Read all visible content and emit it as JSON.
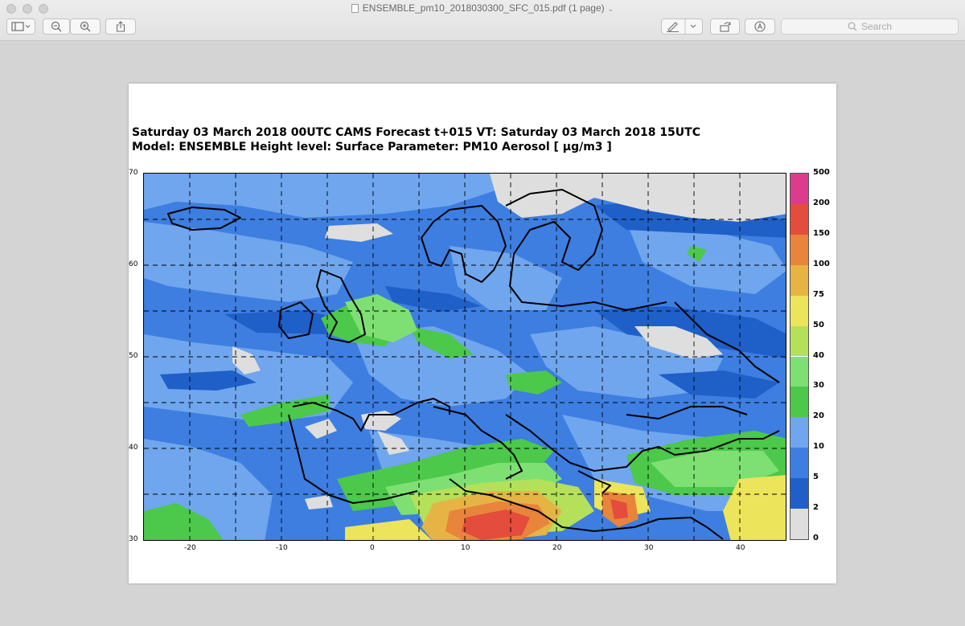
{
  "window": {
    "title": "ENSEMBLE_pm10_2018030300_SFC_015.pdf (1 page)"
  },
  "toolbar": {
    "search_placeholder": "Search",
    "icons": [
      "sidebar-icon",
      "zoom-out-icon",
      "zoom-in-icon",
      "share-icon",
      "markup-pen-icon",
      "rotate-icon",
      "annotate-icon",
      "search-icon"
    ]
  },
  "chart": {
    "title_line1": "Saturday 03 March 2018 00UTC CAMS Forecast t+015 VT: Saturday 03 March 2018 15UTC",
    "title_line2": "Model: ENSEMBLE  Height level: Surface  Parameter: PM10 Aerosol [ µg/m3 ]"
  },
  "chart_data": {
    "type": "heatmap",
    "title": "Saturday 03 March 2018 00UTC CAMS Forecast t+015 VT: Saturday 03 March 2018 15UTC",
    "subtitle": "Model: ENSEMBLE  Height level: Surface  Parameter: PM10 Aerosol [ µg/m3 ]",
    "x_ticks": [
      "-20",
      "-10",
      "0",
      "10",
      "20",
      "30",
      "40"
    ],
    "y_ticks": [
      "30",
      "40",
      "50",
      "60",
      "70"
    ],
    "xlim": [
      -25,
      45
    ],
    "ylim": [
      30,
      70
    ],
    "grid": true,
    "legend": {
      "placement": "right",
      "levels": [
        "0",
        "2",
        "5",
        "10",
        "20",
        "30",
        "40",
        "50",
        "75",
        "100",
        "150",
        "200",
        "500"
      ],
      "colors": [
        "#dedede",
        "#1f5fc8",
        "#3d7ee0",
        "#6fa6ee",
        "#4cc84a",
        "#7ee072",
        "#b5e05a",
        "#ece45a",
        "#e6b444",
        "#e8843c",
        "#e44c3c",
        "#dc3c8c"
      ]
    }
  }
}
